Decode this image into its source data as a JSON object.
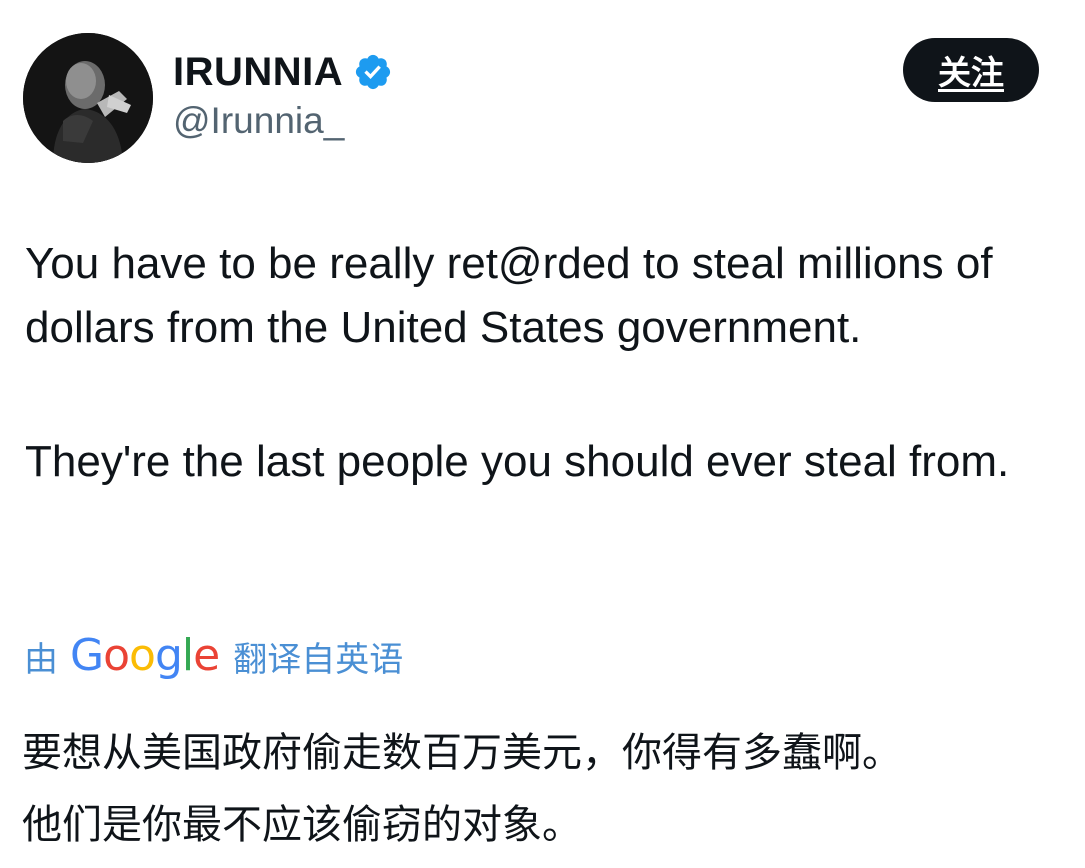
{
  "author": {
    "display_name": "IRUNNIA",
    "handle": "@Irunnia_",
    "verified": true,
    "verified_icon": "verified-check-icon",
    "verified_color": "#1d9bf0"
  },
  "follow_button": {
    "label": "关注"
  },
  "tweet": {
    "paragraphs": [
      "You have to be really ret@rded to steal millions of dollars from the United States government.",
      "They're the last people you should ever steal from."
    ]
  },
  "translation": {
    "prefix": "由",
    "provider": "Google",
    "suffix": "翻译自英语",
    "link_color": "#4a8fd4",
    "google_colors": [
      "#4285f4",
      "#ea4335",
      "#fbbc05",
      "#4285f4",
      "#34a853",
      "#ea4335"
    ],
    "lines": [
      "要想从美国政府偷走数百万美元，你得有多蠢啊。",
      "他们是你最不应该偷窃的对象。"
    ]
  }
}
